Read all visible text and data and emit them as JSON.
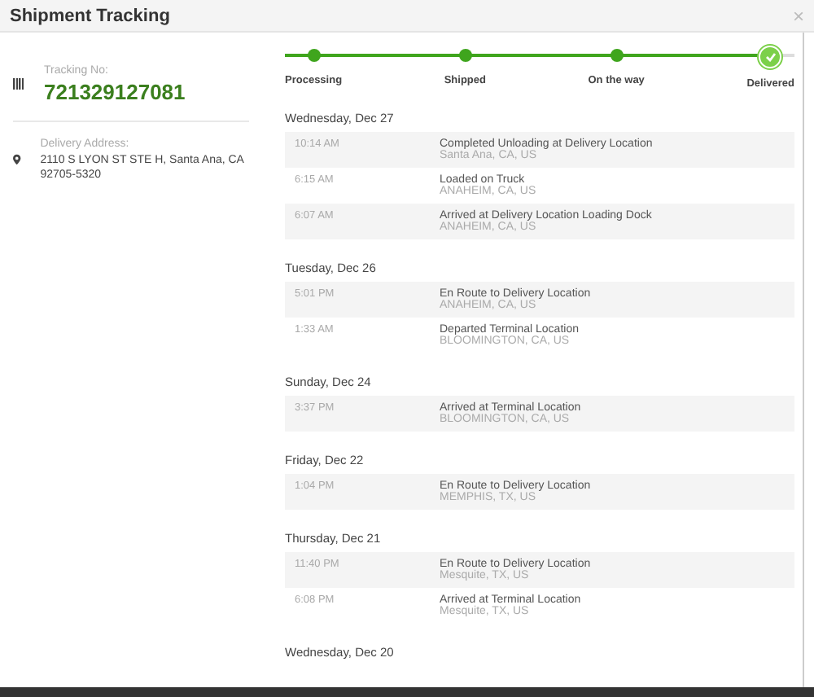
{
  "window": {
    "title": "Shipment Tracking",
    "close": "×"
  },
  "shipment": {
    "tracking_label": "Tracking No:",
    "tracking_number": "721329127081",
    "address_label": "Delivery Address:",
    "address": "2110 S LYON ST STE H, Santa Ana, CA 92705-5320"
  },
  "steps": [
    {
      "label": "Processing",
      "done": true,
      "current": false
    },
    {
      "label": "Shipped",
      "done": true,
      "current": false
    },
    {
      "label": "On the way",
      "done": true,
      "current": false
    },
    {
      "label": "Delivered",
      "done": true,
      "current": true
    }
  ],
  "days": [
    {
      "date": "Wednesday, Dec 27",
      "events": [
        {
          "time": "10:14 AM",
          "status": "Completed Unloading at Delivery Location",
          "location": "Santa Ana, CA, US"
        },
        {
          "time": "6:15 AM",
          "status": "Loaded on Truck",
          "location": "ANAHEIM, CA, US"
        },
        {
          "time": "6:07 AM",
          "status": "Arrived at Delivery Location Loading Dock",
          "location": "ANAHEIM, CA, US"
        }
      ]
    },
    {
      "date": "Tuesday, Dec 26",
      "events": [
        {
          "time": "5:01 PM",
          "status": "En Route to Delivery Location",
          "location": "ANAHEIM, CA, US"
        },
        {
          "time": "1:33 AM",
          "status": "Departed Terminal Location",
          "location": "BLOOMINGTON, CA, US"
        }
      ]
    },
    {
      "date": "Sunday, Dec 24",
      "events": [
        {
          "time": "3:37 PM",
          "status": "Arrived at Terminal Location",
          "location": "BLOOMINGTON, CA, US"
        }
      ]
    },
    {
      "date": "Friday, Dec 22",
      "events": [
        {
          "time": "1:04 PM",
          "status": "En Route to Delivery Location",
          "location": "MEMPHIS, TX, US"
        }
      ]
    },
    {
      "date": "Thursday, Dec 21",
      "events": [
        {
          "time": "11:40 PM",
          "status": "En Route to Delivery Location",
          "location": "Mesquite, TX, US"
        },
        {
          "time": "6:08 PM",
          "status": "Arrived at Terminal Location",
          "location": "Mesquite, TX, US"
        }
      ]
    },
    {
      "date": "Wednesday, Dec 20"
    }
  ]
}
